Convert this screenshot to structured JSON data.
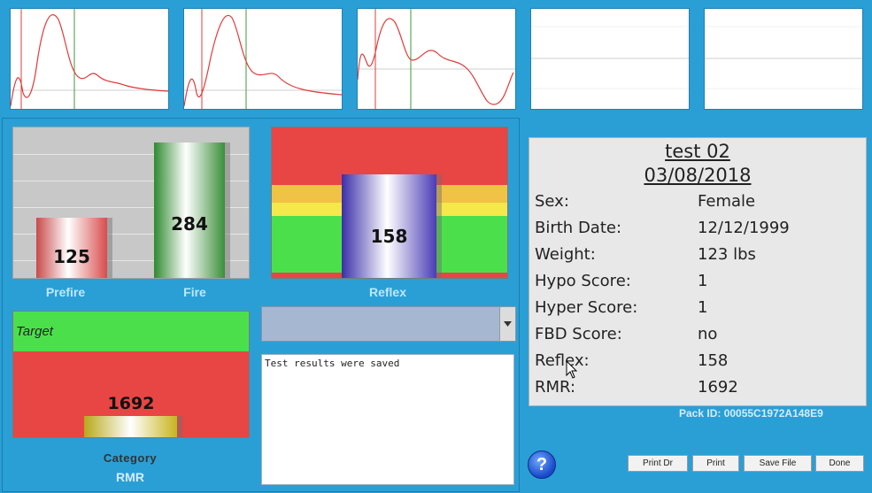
{
  "colors": {
    "background": "#2a9fd6",
    "trace": "#e03b3b",
    "marker": "#3e9a3e",
    "alarm_red": "#e84545",
    "target_green": "#4be04b",
    "band_yellow": "#f0c245"
  },
  "charts": {
    "bars": {
      "prefire": {
        "label": "Prefire",
        "value": "125",
        "level": 125
      },
      "fire": {
        "label": "Fire",
        "value": "284",
        "level": 284
      },
      "ymax": 300
    },
    "reflex": {
      "label": "Reflex",
      "value": "158"
    },
    "rmr": {
      "target_label": "Target",
      "value": "1692",
      "category_label": "Category",
      "label": "RMR"
    }
  },
  "log": {
    "text": "Test results were saved"
  },
  "patient": {
    "name": "test 02",
    "date": "03/08/2018",
    "fields": [
      {
        "key": "Sex:",
        "value": "Female"
      },
      {
        "key": "Birth Date:",
        "value": "12/12/1999"
      },
      {
        "key": "Weight:",
        "value": "123 lbs"
      },
      {
        "key": "Hypo Score:",
        "value": "1"
      },
      {
        "key": "Hyper Score:",
        "value": "1"
      },
      {
        "key": "FBD Score:",
        "value": "no"
      },
      {
        "key": "Reflex:",
        "value": "158"
      },
      {
        "key": "RMR:",
        "value": "1692"
      }
    ],
    "pack_id": "Pack ID: 00055C1972A148E9"
  },
  "buttons": {
    "print_dr": "Print Dr",
    "print": "Print",
    "save_file": "Save File",
    "done": "Done",
    "help": "?"
  },
  "icons": {
    "help": "question-circle-icon",
    "dropdown": "chevron-down-icon",
    "cursor": "mouse-pointer-icon"
  }
}
